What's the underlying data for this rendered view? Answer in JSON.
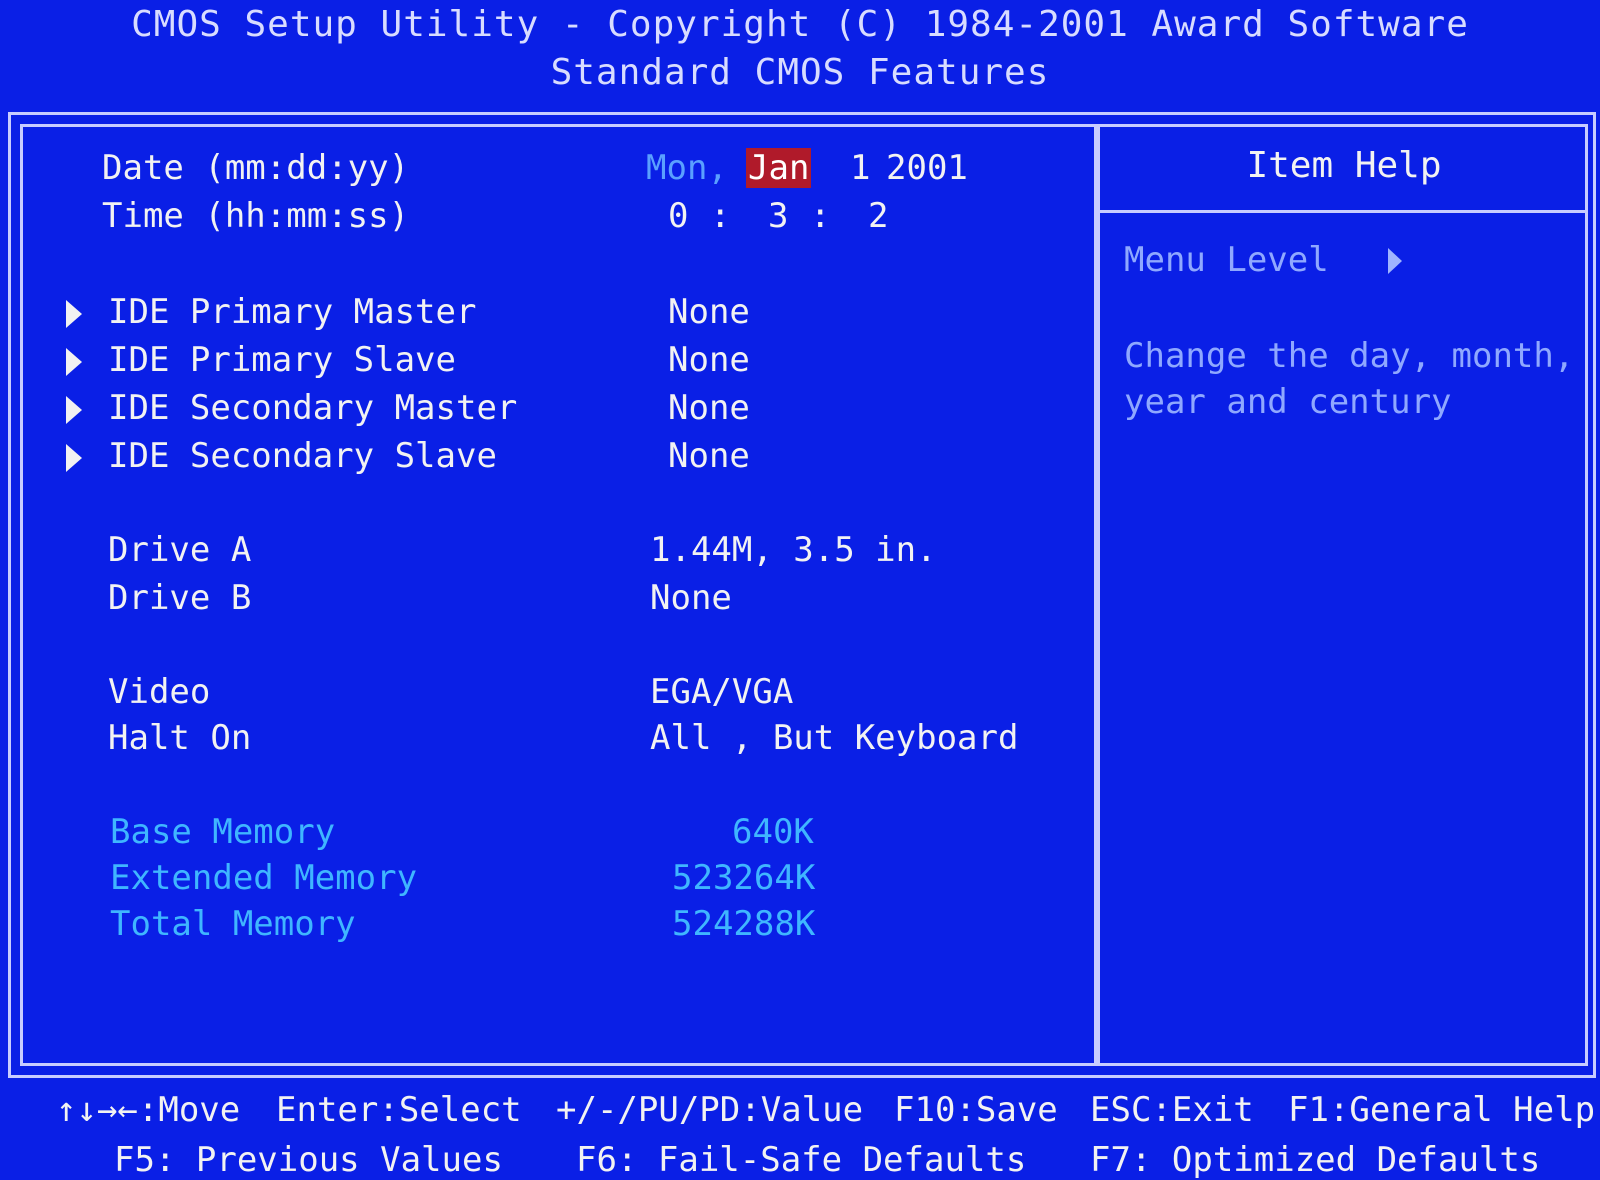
{
  "header": {
    "title": "CMOS Setup Utility - Copyright (C) 1984-2001 Award Software",
    "subtitle": "Standard CMOS Features"
  },
  "settings": {
    "date": {
      "label": "Date (mm:dd:yy)",
      "weekday": "Mon,",
      "month": "Jan",
      "day": "1",
      "year": "2001"
    },
    "time": {
      "label": "Time (hh:mm:ss)",
      "hh": "0",
      "mm": "3",
      "ss": "2",
      "sep": ":"
    },
    "ide": [
      {
        "label": "IDE Primary Master",
        "value": "None"
      },
      {
        "label": "IDE Primary Slave",
        "value": "None"
      },
      {
        "label": "IDE Secondary Master",
        "value": "None"
      },
      {
        "label": "IDE Secondary Slave",
        "value": "None"
      }
    ],
    "drive_a": {
      "label": "Drive A",
      "value": "1.44M, 3.5 in."
    },
    "drive_b": {
      "label": "Drive B",
      "value": "None"
    },
    "video": {
      "label": "Video",
      "value": "EGA/VGA"
    },
    "halt_on": {
      "label": "Halt On",
      "value": "All , But Keyboard"
    },
    "memory": [
      {
        "label": "Base Memory",
        "value": "640K"
      },
      {
        "label": "Extended Memory",
        "value": "523264K"
      },
      {
        "label": "Total Memory",
        "value": "524288K"
      }
    ]
  },
  "help": {
    "title": "Item Help",
    "menu_level": "Menu Level",
    "line1": "Change the day, month,",
    "line2": "year and century"
  },
  "footer": {
    "move": "↑↓→←:Move",
    "select": "Enter:Select",
    "value": "+/-/PU/PD:Value",
    "save": "F10:Save",
    "exit": "ESC:Exit",
    "help": "F1:General Help",
    "prev": "F5: Previous Values",
    "failsafe": "F6: Fail-Safe Defaults",
    "optimized": "F7: Optimized Defaults"
  },
  "colors": {
    "background": "#0a1fe6",
    "highlight": "#b01a2a",
    "cyan_text": "#3fb6ff"
  },
  "icons": {
    "submenu": "triangle-right-icon"
  }
}
